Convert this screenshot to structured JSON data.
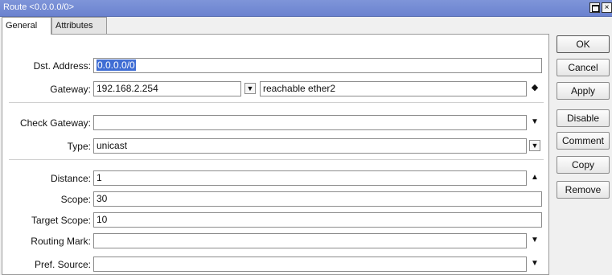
{
  "window": {
    "title": "Route <0.0.0.0/0>",
    "maximize_icon": "maximize-icon",
    "close_glyph": "×"
  },
  "tabs": [
    {
      "label": "General",
      "active": true
    },
    {
      "label": "Attributes",
      "active": false
    }
  ],
  "form": {
    "dst_address": {
      "label": "Dst. Address:",
      "value": "0.0.0.0/0"
    },
    "gateway": {
      "label": "Gateway:",
      "value": "192.168.2.254",
      "status": "reachable ether2"
    },
    "check_gateway": {
      "label": "Check Gateway:",
      "value": ""
    },
    "type": {
      "label": "Type:",
      "value": "unicast"
    },
    "distance": {
      "label": "Distance:",
      "value": "1"
    },
    "scope": {
      "label": "Scope:",
      "value": "30"
    },
    "target_scope": {
      "label": "Target Scope:",
      "value": "10"
    },
    "routing_mark": {
      "label": "Routing Mark:",
      "value": ""
    },
    "pref_source": {
      "label": "Pref. Source:",
      "value": ""
    }
  },
  "buttons": {
    "ok": "OK",
    "cancel": "Cancel",
    "apply": "Apply",
    "disable": "Disable",
    "comment": "Comment",
    "copy": "Copy",
    "remove": "Remove"
  },
  "colors": {
    "titlebar": "#6b82cf",
    "selection": "#3f6dd4"
  }
}
